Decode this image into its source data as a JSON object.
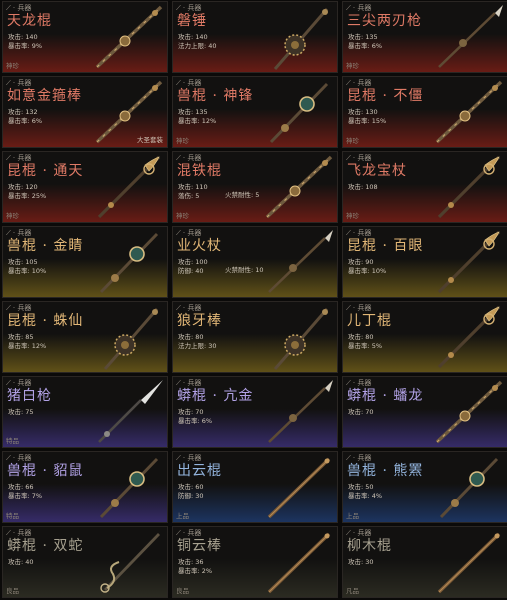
{
  "colors": {
    "red": "#e07a66",
    "gold": "#e2b777",
    "purple": "#b2a2e6",
    "blue": "#93b4dd",
    "gray": "#a6a08f"
  },
  "category": "兵器",
  "cards": [
    {
      "name": "天龙棍",
      "tier": "red",
      "stats": [
        "攻击: 140",
        "暴击率: 9%"
      ],
      "stats2": [],
      "grade": "神珍",
      "extra": "",
      "weapon": "staff"
    },
    {
      "name": "磐锤",
      "tier": "red",
      "stats": [
        "攻击: 140",
        "法力上限: 40"
      ],
      "stats2": [],
      "grade": "",
      "extra": "",
      "weapon": "spiked"
    },
    {
      "name": "三尖两刃枪",
      "tier": "red",
      "stats": [
        "攻击: 135",
        "暴击率: 6%"
      ],
      "stats2": [],
      "grade": "神珍",
      "extra": "",
      "weapon": "spear"
    },
    {
      "name": "如意金箍棒",
      "tier": "red",
      "stats": [
        "攻击: 132",
        "暴击率: 6%"
      ],
      "stats2": [],
      "grade": "",
      "extra": "大圣套装",
      "weapon": "staff"
    },
    {
      "name": "兽棍 · 神锋",
      "tier": "red",
      "stats": [
        "攻击: 135",
        "暴击率: 12%"
      ],
      "stats2": [],
      "grade": "神珍",
      "extra": "",
      "weapon": "orb"
    },
    {
      "name": "昆棍 · 不僵",
      "tier": "red",
      "stats": [
        "攻击: 130",
        "暴击率: 15%"
      ],
      "stats2": [],
      "grade": "神珍",
      "extra": "",
      "weapon": "staff"
    },
    {
      "name": "昆棍 · 通天",
      "tier": "red",
      "stats": [
        "攻击: 120",
        "暴击率: 25%"
      ],
      "stats2": [],
      "grade": "神珍",
      "extra": "",
      "weapon": "ornate"
    },
    {
      "name": "混铁棍",
      "tier": "red",
      "stats": [
        "攻击: 110",
        "落伤: 5"
      ],
      "stats2": [
        "火禁耐性: 5"
      ],
      "grade": "神珍",
      "extra": "",
      "weapon": "staff"
    },
    {
      "name": "飞龙宝杖",
      "tier": "red",
      "stats": [
        "攻击: 108"
      ],
      "stats2": [],
      "grade": "神珍",
      "extra": "",
      "weapon": "ornate"
    },
    {
      "name": "兽棍 · 金睛",
      "tier": "gold",
      "stats": [
        "攻击: 105",
        "暴击率: 10%"
      ],
      "stats2": [],
      "grade": "",
      "extra": "",
      "weapon": "orb"
    },
    {
      "name": "业火杖",
      "tier": "gold",
      "stats": [
        "攻击: 100",
        "防御: 40"
      ],
      "stats2": [
        "火禁耐性: 10"
      ],
      "grade": "",
      "extra": "",
      "weapon": "spear"
    },
    {
      "name": "昆棍 · 百眼",
      "tier": "gold",
      "stats": [
        "攻击: 90",
        "暴击率: 10%"
      ],
      "stats2": [],
      "grade": "",
      "extra": "",
      "weapon": "ornate"
    },
    {
      "name": "昆棍 · 蛛仙",
      "tier": "gold",
      "stats": [
        "攻击: 85",
        "暴击率: 12%"
      ],
      "stats2": [],
      "grade": "",
      "extra": "",
      "weapon": "spiked"
    },
    {
      "name": "狼牙棒",
      "tier": "gold",
      "stats": [
        "攻击: 80",
        "法力上限: 30"
      ],
      "stats2": [],
      "grade": "",
      "extra": "",
      "weapon": "spiked"
    },
    {
      "name": "儿丁棍",
      "tier": "gold",
      "stats": [
        "攻击: 80",
        "暴击率: 5%"
      ],
      "stats2": [],
      "grade": "",
      "extra": "",
      "weapon": "ornate"
    },
    {
      "name": "猪白枪",
      "tier": "purple",
      "stats": [
        "攻击: 75"
      ],
      "stats2": [],
      "grade": "特品",
      "extra": "",
      "weapon": "blade"
    },
    {
      "name": "蟒棍 · 亢金",
      "tier": "purple",
      "stats": [
        "攻击: 70",
        "暴击率: 6%"
      ],
      "stats2": [],
      "grade": "",
      "extra": "",
      "weapon": "spear"
    },
    {
      "name": "蟒棍 · 蟠龙",
      "tier": "purple",
      "stats": [
        "攻击: 70"
      ],
      "stats2": [],
      "grade": "",
      "extra": "",
      "weapon": "staff"
    },
    {
      "name": "兽棍 · 貂鼠",
      "tier": "purple",
      "stats": [
        "攻击: 66",
        "暴击率: 7%"
      ],
      "stats2": [],
      "grade": "特品",
      "extra": "",
      "weapon": "orb"
    },
    {
      "name": "出云棍",
      "tier": "blue",
      "stats": [
        "攻击: 60",
        "防御: 30"
      ],
      "stats2": [],
      "grade": "上品",
      "extra": "",
      "weapon": "plain"
    },
    {
      "name": "兽棍 · 熊罴",
      "tier": "blue",
      "stats": [
        "攻击: 50",
        "暴击率: 4%"
      ],
      "stats2": [],
      "grade": "上品",
      "extra": "",
      "weapon": "orb"
    },
    {
      "name": "蟒棍 · 双蛇",
      "tier": "gray",
      "stats": [
        "攻击: 40"
      ],
      "stats2": [],
      "grade": "良品",
      "extra": "",
      "weapon": "snake"
    },
    {
      "name": "铜云棒",
      "tier": "gray",
      "stats": [
        "攻击: 36",
        "暴击率: 2%"
      ],
      "stats2": [],
      "grade": "良品",
      "extra": "",
      "weapon": "plain"
    },
    {
      "name": "柳木棍",
      "tier": "gray",
      "stats": [
        "攻击: 30"
      ],
      "stats2": [],
      "grade": "凡品",
      "extra": "",
      "weapon": "plain"
    }
  ]
}
